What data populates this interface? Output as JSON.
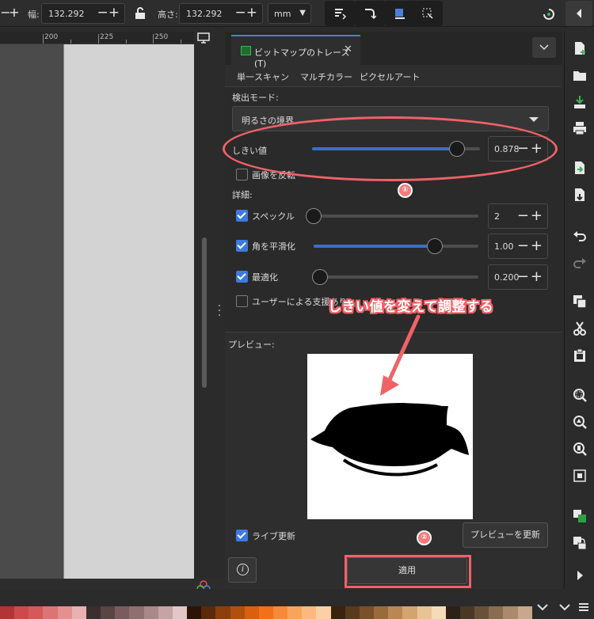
{
  "toolbar": {
    "width_label": "幅:",
    "width_value": "132.292",
    "height_label": "高さ:",
    "height_value": "132.292",
    "unit": "mm"
  },
  "ruler": {
    "labels": [
      "200",
      "225",
      "250"
    ]
  },
  "dock": {
    "tab_label": "ビットマップのトレース(T)",
    "subtabs": [
      "単一スキャン",
      "マルチカラー",
      "ピクセルアート"
    ],
    "detection_mode_label": "検出モード:",
    "detection_mode_value": "明るさの境界",
    "threshold_label": "しきい値",
    "threshold_value": "0.878",
    "threshold_level": 0.878,
    "invert_label": "画像を反転",
    "invert_checked": false,
    "details_label": "詳細:",
    "speckles_label": "スペックル",
    "speckles_value": "2",
    "speckles_checked": true,
    "smooth_corners_label": "角を平滑化",
    "smooth_corners_value": "1.00",
    "smooth_corners_checked": true,
    "optimize_label": "最適化",
    "optimize_value": "0.200",
    "optimize_checked": true,
    "user_assist_label": "ユーザーによる支援あり",
    "user_assist_checked": false,
    "preview_label": "プレビュー:",
    "live_update_label": "ライブ更新",
    "live_update_checked": true,
    "update_preview_button": "プレビューを更新",
    "apply_button": "適用"
  },
  "annotations": {
    "callout_text": "しきい値を変えて調整する",
    "badge_1": "①",
    "badge_2": "②",
    "color": "#f06268"
  },
  "icons": {
    "command_bar": [
      "new-document-icon",
      "open-icon",
      "import-icon",
      "print-icon",
      "export-icon",
      "save-as-icon",
      "undo-icon",
      "redo-icon",
      "duplicate-icon",
      "cut-icon",
      "paste-icon",
      "zoom-selection-icon",
      "zoom-drawing-icon",
      "zoom-page-icon",
      "zoom-fit-icon",
      "fill-stroke-icon",
      "lock-icon",
      "more-icon",
      "menu-icon"
    ]
  },
  "palette": [
    "#b23434",
    "#cc4a4a",
    "#d45a5a",
    "#dc7474",
    "#e39090",
    "#e8b0b0",
    "#3a2e2e",
    "#5a4444",
    "#7a5c5c",
    "#8f7070",
    "#a88888",
    "#c4a4a4",
    "#e3c6c6",
    "#2b1406",
    "#5a2a0a",
    "#8a3f0c",
    "#b0500e",
    "#d86010",
    "#f27018",
    "#f58a3a",
    "#f8a45c",
    "#fab97e",
    "#fcd0a4",
    "#3a2410",
    "#5a3a1c",
    "#7a502a",
    "#9a6a3a",
    "#ba8654",
    "#d4a470",
    "#e8c494",
    "#f4dcb8",
    "#2d2016",
    "#4a3826",
    "#6a5038",
    "#8a6c50",
    "#aa8a6a",
    "#c6a88a"
  ]
}
